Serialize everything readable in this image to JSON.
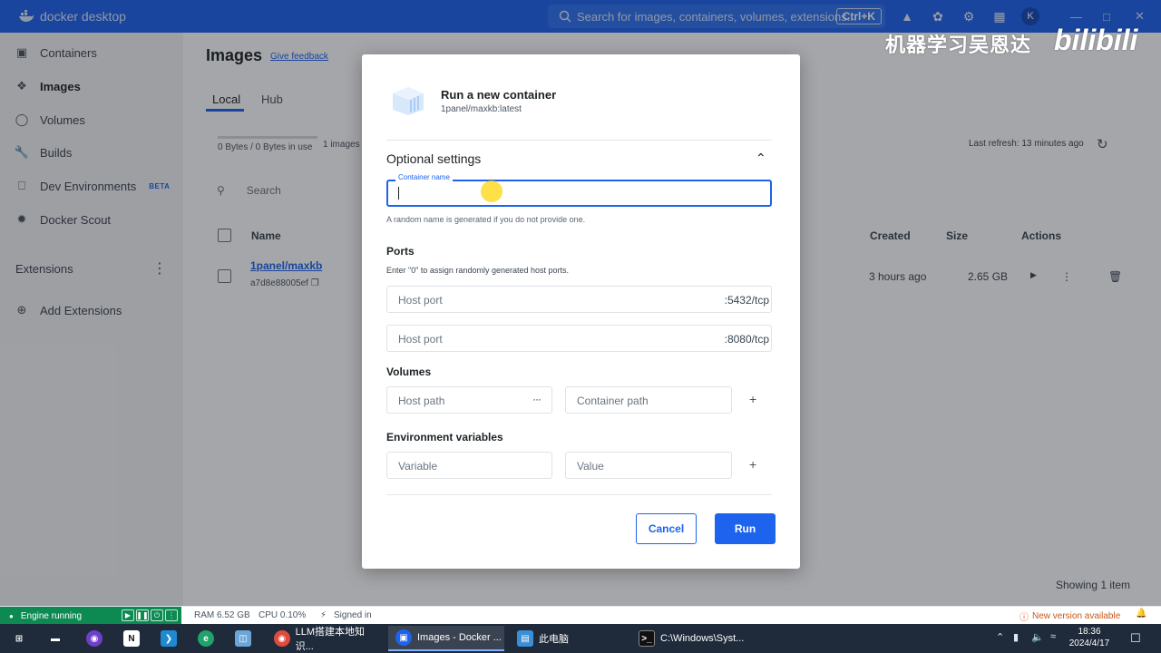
{
  "titlebar": {
    "app_name": "docker desktop",
    "search_placeholder": "Search for images, containers, volumes, extensions...",
    "search_shortcut": "Ctrl+K",
    "avatar_initial": "K"
  },
  "sidebar": {
    "items": [
      {
        "label": "Containers",
        "icon": "containers-icon"
      },
      {
        "label": "Images",
        "icon": "images-icon"
      },
      {
        "label": "Volumes",
        "icon": "volumes-icon"
      },
      {
        "label": "Builds",
        "icon": "builds-icon"
      },
      {
        "label": "Dev Environments",
        "icon": "dev-environments-icon",
        "badge": "BETA"
      },
      {
        "label": "Docker Scout",
        "icon": "docker-scout-icon"
      }
    ],
    "extensions_label": "Extensions",
    "add_extensions_label": "Add Extensions"
  },
  "page": {
    "title": "Images",
    "feedback": "Give feedback",
    "tabs": [
      "Local",
      "Hub"
    ],
    "usage": "0 Bytes / 0 Bytes in use",
    "image_count": "1 images",
    "search_placeholder": "Search",
    "last_refresh": "Last refresh: 13 minutes ago",
    "columns": {
      "name": "Name",
      "created": "Created",
      "size": "Size",
      "actions": "Actions"
    },
    "rows": [
      {
        "name": "1panel/maxkb",
        "id": "a7d8e88005ef",
        "status_fragment": "d",
        "created": "3 hours ago",
        "size": "2.65 GB"
      }
    ],
    "showing": "Showing 1 item"
  },
  "watermark": {
    "text": "机器学习吴恩达",
    "brand": "bilibili"
  },
  "modal": {
    "title": "Run a new container",
    "image": "1panel/maxkb:latest",
    "optional_settings": "Optional settings",
    "container_name_label": "Container name",
    "container_name_value": "",
    "container_name_help": "A random name is generated if you do not provide one.",
    "ports_title": "Ports",
    "ports_help": "Enter \"0\" to assign randomly generated host ports.",
    "ports": [
      {
        "placeholder": "Host port",
        "container_port": ":5432/tcp"
      },
      {
        "placeholder": "Host port",
        "container_port": ":8080/tcp"
      }
    ],
    "volumes_title": "Volumes",
    "host_path_placeholder": "Host path",
    "container_path_placeholder": "Container path",
    "env_title": "Environment variables",
    "variable_placeholder": "Variable",
    "value_placeholder": "Value",
    "cancel": "Cancel",
    "run": "Run"
  },
  "statusbar": {
    "engine": "Engine running",
    "ram": "RAM 6.52 GB",
    "cpu": "CPU 0.10%",
    "signed_in": "Signed in",
    "new_version": "New version available"
  },
  "taskbar": {
    "apps": [
      {
        "label": "LLM搭建本地知识...",
        "icon": "chrome-icon"
      },
      {
        "label": "Images - Docker ...",
        "icon": "docker-icon"
      },
      {
        "label": "此电脑",
        "icon": "this-pc-icon"
      },
      {
        "label": "C:\\Windows\\Syst...",
        "icon": "cmd-icon"
      }
    ],
    "time": "18:36",
    "date": "2024/4/17"
  },
  "colors": {
    "accent": "#1d63ed",
    "engine_green": "#0d8a52",
    "warning": "#c85a1a"
  }
}
